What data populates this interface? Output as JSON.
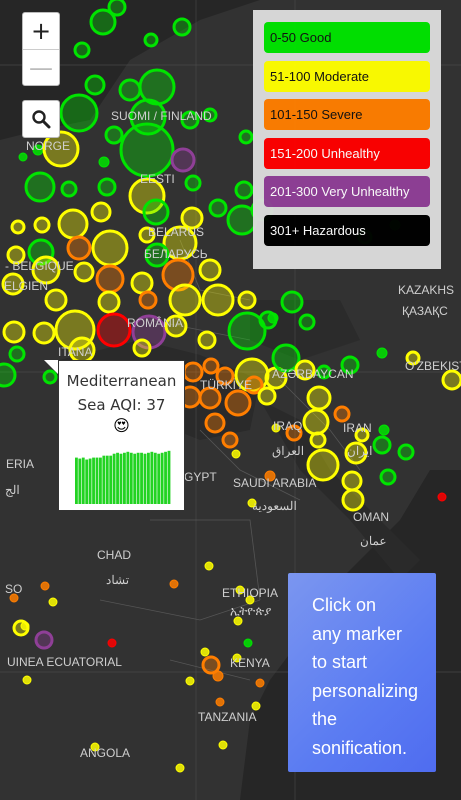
{
  "colors": {
    "good": "#00e400",
    "moderate": "#ffff00",
    "severe": "#ff7e00",
    "unhealthy": "#ff0000",
    "very_unhealthy": "#8f3f97",
    "hazardous": "#000000"
  },
  "controls": {
    "zoom_in": "+",
    "zoom_out": "—",
    "search_icon": "magnifier-icon"
  },
  "legend": {
    "items": [
      {
        "label": "0-50 Good",
        "color": "#00e400"
      },
      {
        "label": "51-100 Moderate",
        "color": "#ffff00"
      },
      {
        "label": "101-150 Severe",
        "color": "#ff7e00"
      },
      {
        "label": "151-200 Unhealthy",
        "color": "#ff0000"
      },
      {
        "label": "201-300 Very Unhealthy",
        "color": "#8f3f97"
      },
      {
        "label": "301+ Hazardous",
        "color": "#000000"
      }
    ]
  },
  "popup": {
    "line1": "Mediterranean",
    "line2": "Sea AQI: 37",
    "emoji": "😍",
    "history": [
      48,
      47,
      48,
      46,
      47,
      48,
      48,
      48,
      50,
      50,
      50,
      52,
      53,
      52,
      53,
      54,
      53,
      52,
      53,
      53,
      52,
      53,
      54,
      53,
      52,
      53,
      54,
      55
    ]
  },
  "info": {
    "lines": [
      "Click on",
      "any marker",
      "to start",
      "personalizing",
      "the",
      "sonification."
    ]
  },
  "map_labels": {
    "finland": "SUOMI / FINLAND",
    "norge": "NORGE",
    "eesti": "EESTI",
    "belarus": "BELARUS",
    "belarus_cyr": "БЕЛАРУСЬ",
    "belgique": "- BELGIQUE",
    "elgien": "ELGIEN",
    "romania": "ROMÂNIA",
    "itana": "ITANA",
    "kazakhs": "KAZAKHS",
    "kazakhs_cyr": "ҚАЗАҚС",
    "ozbekisto": "O'ZBEKISTO",
    "turkiye": "TÜRKİYE",
    "azerbaycan": "AZƏRBAYCAN",
    "iraq": "IRAQ",
    "iraq_ar": "العراق",
    "iran": "IRAN",
    "iran_ar": "ایران",
    "eria": "ERIA",
    "eria_ar": "الج",
    "gypt": "GYPT",
    "saudi": "SAUDI ARABIA",
    "saudi_ar": "السعودية",
    "oman": "OMAN",
    "oman_ar": "عمان",
    "chad": "CHAD",
    "chad_ar": "تشاد",
    "so": "SO",
    "ethiopia": "ETHIOPIA",
    "ethiopia_amh": "ኢትዮጵያ",
    "guinea": "UINEA ECUATORIAL",
    "kenya": "KENYA",
    "tanzania": "TANZANIA",
    "angola": "ANGOLA"
  }
}
